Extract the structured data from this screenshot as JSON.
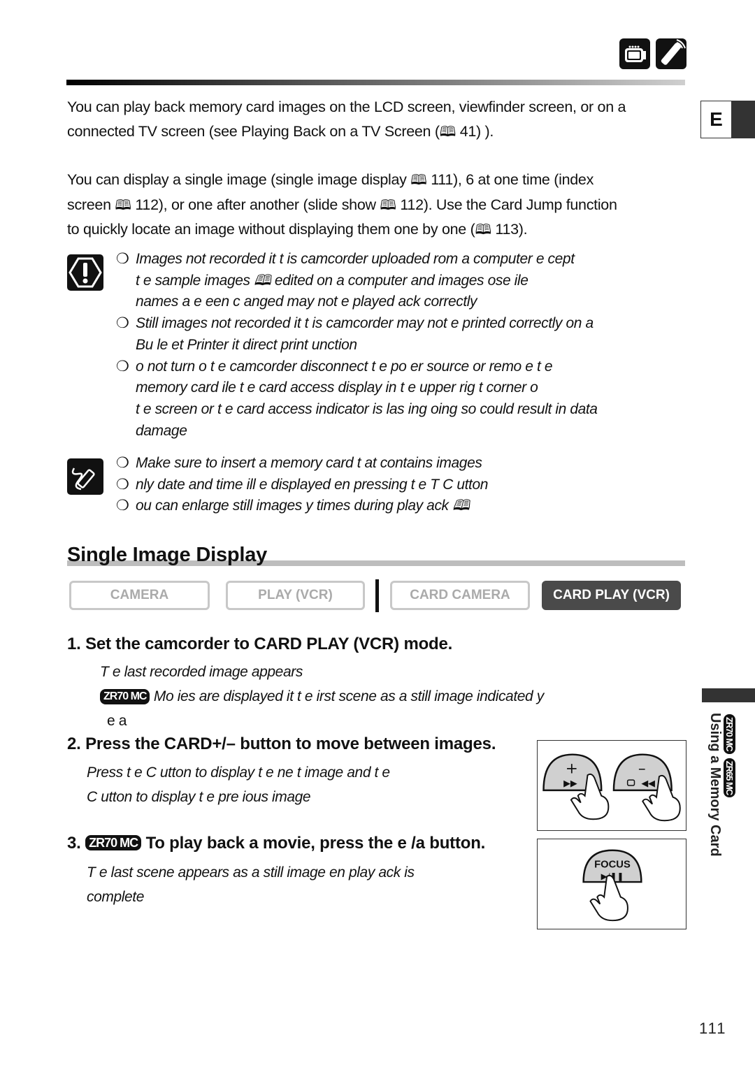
{
  "header": {
    "icons": [
      "camcorder-icon",
      "remote-control-icon"
    ],
    "language_tab": "E"
  },
  "intro": {
    "para1_line1": "You can play back memory card images on the LCD screen, viewfinder screen, or on a",
    "para1_line2_a": "connected TV screen (see Playing Back on a TV Screen (",
    "para1_line2_b": " 41) ).",
    "para2_line1_a": "You can display a single image (single image display ",
    "para2_line1_b": " 111), 6 at one time (index",
    "para2_line2_a": "screen ",
    "para2_line2_b": " 112), or one after another (slide show ",
    "para2_line2_c": " 112). Use the Card Jump function",
    "para2_line3_a": "to quickly locate an image without displaying them one by one (",
    "para2_line3_b": " 113).",
    "book_glyph": "🕮"
  },
  "cautions": {
    "icon": "caution-icon",
    "bullet_glyph": "❍",
    "items": [
      {
        "lines": [
          "Images not recorded   it   t  is camcorder  uploaded   rom a computer  e  cept",
          "t  e sample images 🕮            edited on a computer and images      ose  ile",
          "names    a  e    een c  anged may not    e played    ack correctly"
        ]
      },
      {
        "lines": [
          "Still images not recorded    it    t  is camcorder may not    e printed correctly on a",
          "Bu     le   et Printer    it   direct print  unction"
        ]
      },
      {
        "lines": [
          "  o not turn o     t  e camcorder  disconnect t  e po    er source or remo  e t  e",
          "memory card      ile t  e card access display            in t  e upper rig  t corner o",
          "t  e screen or t  e card access indicator is   las  ing     oing so could result in data",
          "damage"
        ]
      }
    ]
  },
  "notes": {
    "icon": "note-pencil-icon",
    "items": [
      {
        "lines": [
          "Make sure to insert a memory card t  at contains images"
        ]
      },
      {
        "lines": [
          "  nly date and time    ill   e displayed      en pressing t  e     T   C            utton"
        ]
      },
      {
        "lines": [
          "  ou can enlarge still images    y     times during play  ack  🕮"
        ]
      }
    ]
  },
  "section": {
    "title": "Single Image Display",
    "modes": [
      {
        "label": "CAMERA",
        "active": false
      },
      {
        "label": "PLAY (VCR)",
        "active": false
      },
      {
        "label": "CARD CAMERA",
        "active": false
      },
      {
        "label": "CARD PLAY (VCR)",
        "active": true
      }
    ]
  },
  "steps": [
    {
      "title": "1. Set the camcorder to CARD PLAY (VCR) mode.",
      "lines": [
        "T  e last recorded image appears"
      ],
      "badge_line": {
        "badge": "ZR70 MC",
        "text": "Mo  ies are displayed    it   t  e   irst scene as a still image indicated    y"
      },
      "tail": "e  a"
    },
    {
      "title": "2. Press the CARD+/– button to move between images.",
      "lines": [
        "Press  t  e C             utton to display t  e ne  t image and t  e",
        "C             utton to display t  e pre  ious image"
      ]
    },
    {
      "number": "3.",
      "badge": "ZR70 MC",
      "title": "To play back a movie, press the e /a  button.",
      "lines": [
        "T  e last scene appears as a still image       en play  ack is",
        "complete"
      ]
    }
  ],
  "illustrations": {
    "card_buttons": {
      "plus": "+",
      "minus": "–",
      "ff": "▶▶",
      "rew": "◀◀"
    },
    "focus_button": {
      "label": "FOCUS",
      "play_pause": "▶/❚❚"
    }
  },
  "sidebar": {
    "badges": [
      "ZR70 MC",
      "ZR65 MC"
    ],
    "label": "Using a Memory Card"
  },
  "footer": {
    "page_number": "111"
  }
}
